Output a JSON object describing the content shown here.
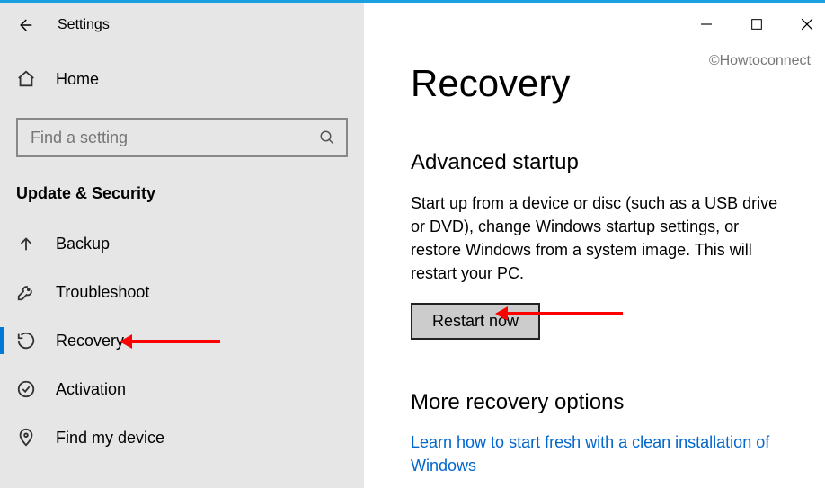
{
  "window": {
    "title": "Settings",
    "watermark": "©Howtoconnect"
  },
  "sidebar": {
    "home": "Home",
    "search_placeholder": "Find a setting",
    "category": "Update & Security",
    "items": [
      {
        "label": "Backup"
      },
      {
        "label": "Troubleshoot"
      },
      {
        "label": "Recovery"
      },
      {
        "label": "Activation"
      },
      {
        "label": "Find my device"
      }
    ]
  },
  "main": {
    "page_title": "Recovery",
    "section1_head": "Advanced startup",
    "section1_body": "Start up from a device or disc (such as a USB drive or DVD), change Windows startup settings, or restore Windows from a system image. This will restart your PC.",
    "restart_button": "Restart now",
    "section2_head": "More recovery options",
    "link_text": "Learn how to start fresh with a clean installation of Windows"
  }
}
